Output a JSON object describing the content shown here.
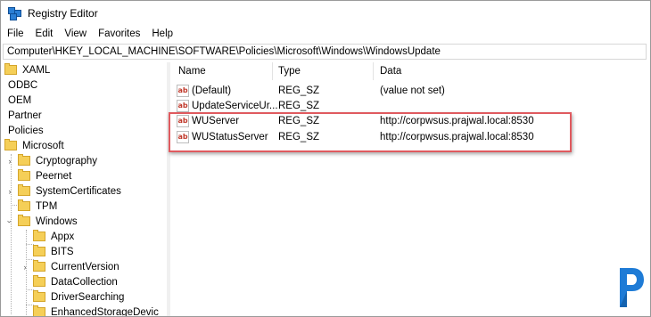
{
  "window": {
    "title": "Registry Editor"
  },
  "menu": [
    "File",
    "Edit",
    "View",
    "Favorites",
    "Help"
  ],
  "address_bar": {
    "value": "Computer\\HKEY_LOCAL_MACHINE\\SOFTWARE\\Policies\\Microsoft\\Windows\\WindowsUpdate"
  },
  "tree": [
    {
      "label": "XAML",
      "folder": true
    },
    {
      "label": "ODBC",
      "folder": false
    },
    {
      "label": "OEM",
      "folder": false
    },
    {
      "label": "Partner",
      "folder": false
    },
    {
      "label": "Policies",
      "folder": false
    },
    {
      "label": "Microsoft",
      "folder": true
    },
    {
      "label": "Cryptography",
      "folder": true,
      "expander": "collapsed"
    },
    {
      "label": "Peernet",
      "folder": true
    },
    {
      "label": "SystemCertificates",
      "folder": true,
      "expander": "collapsed"
    },
    {
      "label": "TPM",
      "folder": true
    },
    {
      "label": "Windows",
      "folder": true,
      "expander": "expanded"
    },
    {
      "label": "Appx",
      "folder": true
    },
    {
      "label": "BITS",
      "folder": true
    },
    {
      "label": "CurrentVersion",
      "folder": true,
      "expander": "collapsed"
    },
    {
      "label": "DataCollection",
      "folder": true
    },
    {
      "label": "DriverSearching",
      "folder": true
    },
    {
      "label": "EnhancedStorageDevic",
      "folder": true
    }
  ],
  "columns": {
    "name": "Name",
    "type": "Type",
    "data": "Data"
  },
  "values": [
    {
      "name": "(Default)",
      "type": "REG_SZ",
      "data": "(value not set)"
    },
    {
      "name": "UpdateServiceUr...",
      "type": "REG_SZ",
      "data": ""
    },
    {
      "name": "WUServer",
      "type": "REG_SZ",
      "data": "http://corpwsus.prajwal.local:8530"
    },
    {
      "name": "WUStatusServer",
      "type": "REG_SZ",
      "data": "http://corpwsus.prajwal.local:8530"
    }
  ],
  "value_icon_text": "ab",
  "colors": {
    "highlight_border": "#e05a5f",
    "folder": "#f5cf58",
    "logo": "#1e7bd6"
  }
}
